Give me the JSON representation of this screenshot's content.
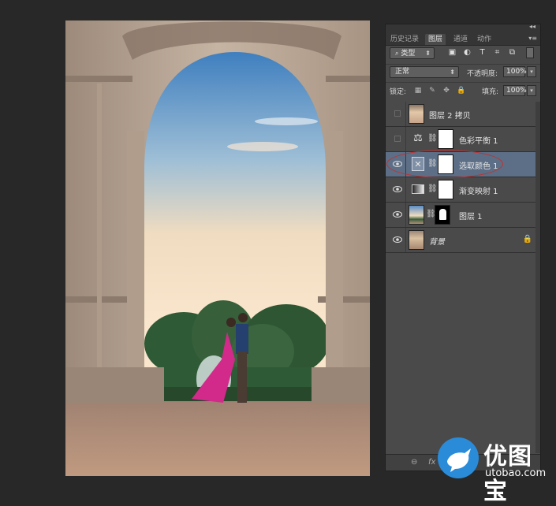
{
  "panel": {
    "tabs": [
      "历史记录",
      "图层",
      "通道",
      "动作"
    ],
    "active_tab": "图层",
    "filter": {
      "label": "类型",
      "icons": [
        "image-filter-icon",
        "adjustment-filter-icon",
        "text-filter-icon",
        "shape-filter-icon",
        "smart-object-filter-icon"
      ]
    },
    "blend_mode": "正常",
    "opacity_label": "不透明度:",
    "opacity_value": "100%",
    "lock_label": "锁定:",
    "fill_label": "填充:",
    "fill_value": "100%",
    "layers": [
      {
        "name": "图层 2 拷贝",
        "visible": false,
        "type": "pixel"
      },
      {
        "name": "色彩平衡 1",
        "visible": false,
        "type": "adjustment",
        "icon": "balance-scale-icon"
      },
      {
        "name": "选取颜色 1",
        "visible": true,
        "type": "adjustment",
        "icon": "selective-color-icon",
        "selected": true
      },
      {
        "name": "渐变映射 1",
        "visible": true,
        "type": "adjustment",
        "icon": "gradient-map-icon"
      },
      {
        "name": "图层 1",
        "visible": true,
        "type": "pixel-with-mask"
      },
      {
        "name": "背景",
        "visible": true,
        "type": "background",
        "locked": true
      }
    ],
    "bottom_icons": [
      "link-icon",
      "fx-icon"
    ]
  },
  "watermark": {
    "title": "优图宝",
    "url": "utobao.com"
  },
  "colors": {
    "panel_bg": "#4a4a4a",
    "selected_layer": "#5d6f86",
    "annotation": "#c03030",
    "app_bg": "#282828"
  }
}
